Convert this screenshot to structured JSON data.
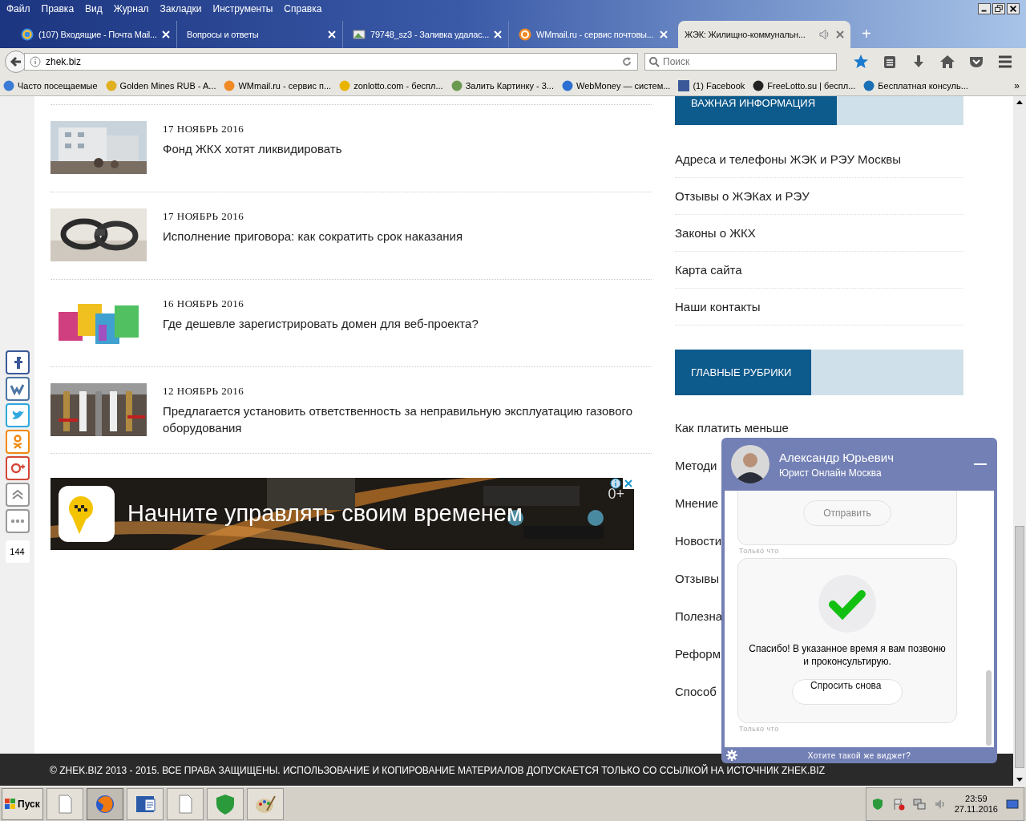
{
  "menu_bar": [
    "Файл",
    "Правка",
    "Вид",
    "Журнал",
    "Закладки",
    "Инструменты",
    "Справка"
  ],
  "tabs": [
    {
      "title": "(107) Входящие - Почта Mail...",
      "selected": false,
      "audio": false
    },
    {
      "title": "Вопросы и ответы",
      "selected": false,
      "audio": false
    },
    {
      "title": "79748_sz3 - Заливка удалас...",
      "selected": false,
      "audio": false
    },
    {
      "title": "WMmail.ru - сервис почтовы...",
      "selected": false,
      "audio": false
    },
    {
      "title": "ЖЭК: Жилищно-коммунальн...",
      "selected": true,
      "audio": true
    }
  ],
  "new_tab": "+",
  "address": "zhek.biz",
  "search": {
    "placeholder": "Поиск"
  },
  "bookmarks": [
    "Часто посещаемые",
    "Golden Mines RUB - A...",
    "WMmail.ru - сервис п...",
    "zonlotto.com - беспл...",
    "Залить Картинку - 3...",
    "WebMoney — систем...",
    "(1) Facebook",
    "FreeLotto.su | беспл...",
    "Бесплатная консуль..."
  ],
  "bookmarks_more": "»",
  "articles": [
    {
      "date": "17 НОЯБРЬ 2016",
      "title": "Фонд ЖКХ хотят ликвидировать"
    },
    {
      "date": "17 НОЯБРЬ 2016",
      "title": "Исполнение приговора: как сократить срок наказания"
    },
    {
      "date": "16 НОЯБРЬ 2016",
      "title": "Где дешевле зарегистрировать домен для веб-проекта?"
    },
    {
      "date": "12 НОЯБРЬ 2016",
      "title": "Предлагается установить ответственность за неправильную эксплуатацию газового оборудования"
    }
  ],
  "ad": {
    "text": "Начните управлять своим временем",
    "age": "0+"
  },
  "share_count": "144",
  "sidebar": [
    {
      "heading": "ВАЖНАЯ ИНФОРМАЦИЯ",
      "links": [
        "Адреса и телефоны ЖЭК и РЭУ Москвы",
        "Отзывы о ЖЭКах и РЭУ",
        "Законы о ЖКХ",
        "Карта сайта",
        "Наши контакты"
      ]
    },
    {
      "heading": "ГЛАВНЫЕ РУБРИКИ",
      "links": [
        "Как платить меньше",
        "Методи",
        "Мнение",
        "Новости",
        "Отзывы",
        "Полезна",
        "Реформ",
        "Способ"
      ]
    }
  ],
  "chat": {
    "name": "Александр Юрьевич",
    "role": "Юрист Онлайн Москва",
    "messages": [
      {
        "kind": "form",
        "button": "Отправить",
        "time": "Только что"
      },
      {
        "kind": "success",
        "text": "Спасибо! В указанное время я вам позвоню и проконсультирую.",
        "button": "Спросить снова",
        "time": "Только что"
      }
    ],
    "footer": "Хотите такой же виджет?"
  },
  "footer": "© ZHEK.BIZ 2013 - 2015. ВСЕ ПРАВА ЗАЩИЩЕНЫ. ИСПОЛЬЗОВАНИЕ И КОПИРОВАНИЕ МАТЕРИАЛОВ ДОПУСКАЕТСЯ ТОЛЬКО СО ССЫЛКОЙ НА ИСТОЧНИК ZHEK.BIZ",
  "taskbar": {
    "start": "Пуск",
    "time": "23:59",
    "date": "27.11.2016"
  }
}
